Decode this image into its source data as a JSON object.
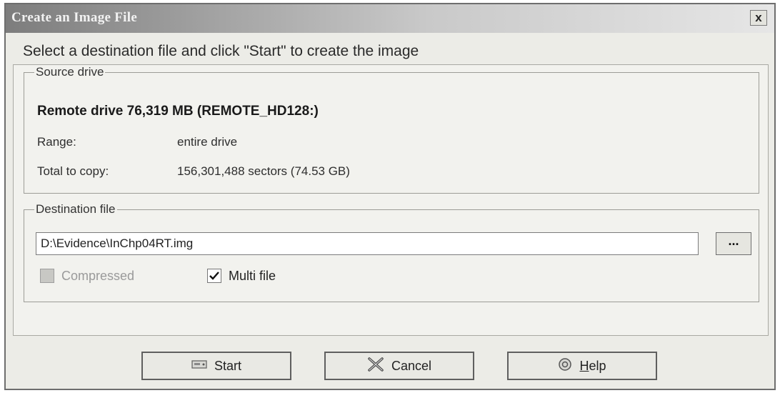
{
  "window": {
    "title": "Create an Image File",
    "close_label": "x"
  },
  "instruction": "Select a destination file and click \"Start\" to create the image",
  "source": {
    "legend": "Source drive",
    "drive_name": "Remote drive 76,319 MB (REMOTE_HD128:)",
    "range_label": "Range:",
    "range_value": "entire drive",
    "total_label": "Total to copy:",
    "total_value": "156,301,488 sectors (74.53 GB)"
  },
  "destination": {
    "legend": "Destination file",
    "path_value": "D:\\Evidence\\InChp04RT.img",
    "browse_label": "...",
    "compressed_label": "Compressed",
    "compressed_checked": false,
    "compressed_enabled": false,
    "multifile_label": "Multi file",
    "multifile_checked": true
  },
  "buttons": {
    "start_label": "Start",
    "cancel_label": "Cancel",
    "help_label_rest": "elp",
    "help_label_hotkey": "H"
  },
  "icons": {
    "start": "drive-icon",
    "cancel": "cancel-x-icon",
    "help": "help-icon"
  }
}
